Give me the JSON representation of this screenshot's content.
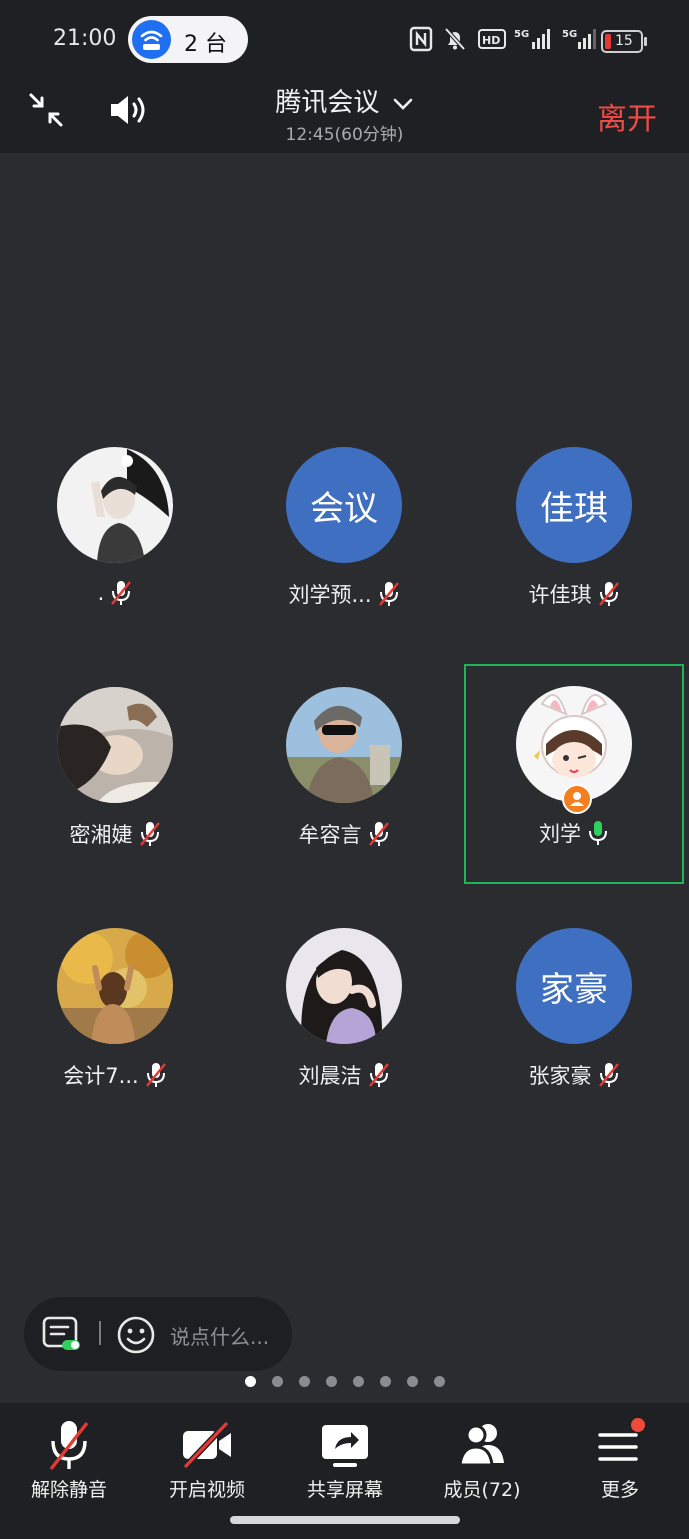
{
  "status_bar": {
    "time": "21:00",
    "pill_count": "2 台",
    "battery": "15",
    "icons": [
      "nfc-icon",
      "mute-bell-icon",
      "hd-icon",
      "signal-5g-icon",
      "signal-5g-icon",
      "battery-icon"
    ]
  },
  "header": {
    "title": "腾讯会议",
    "duration": "12:45(60分钟)",
    "leave_label": "离开",
    "leave_color": "#f24b45"
  },
  "participants": [
    {
      "name": ".",
      "avatar_type": "photo",
      "mic": "muted"
    },
    {
      "name": "刘学预...",
      "avatar_text": "会议",
      "avatar_type": "text",
      "mic": "muted"
    },
    {
      "name": "许佳琪",
      "avatar_text": "佳琪",
      "avatar_type": "text",
      "mic": "muted"
    },
    {
      "name": "密湘婕",
      "avatar_type": "photo",
      "mic": "muted"
    },
    {
      "name": "牟容言",
      "avatar_type": "photo",
      "mic": "muted"
    },
    {
      "name": "刘学",
      "avatar_type": "photo",
      "mic": "speaking",
      "active": true
    },
    {
      "name": "会计7...",
      "avatar_type": "photo",
      "mic": "muted"
    },
    {
      "name": "刘晨洁",
      "avatar_type": "photo",
      "mic": "muted"
    },
    {
      "name": "张家豪",
      "avatar_text": "家豪",
      "avatar_type": "text",
      "mic": "muted"
    }
  ],
  "chat": {
    "placeholder": "说点什么..."
  },
  "pagination": {
    "pages": 8,
    "current": 1
  },
  "toolbar": {
    "unmute": "解除静音",
    "video": "开启视频",
    "share": "共享屏幕",
    "members": "成员(72)",
    "more": "更多"
  },
  "colors": {
    "avatar_blue": "#3f6fc1",
    "active_border": "#1fb35a",
    "mic_active": "#2fd15e",
    "mute_slash": "#e53935",
    "notify_dot": "#f04a3a"
  }
}
